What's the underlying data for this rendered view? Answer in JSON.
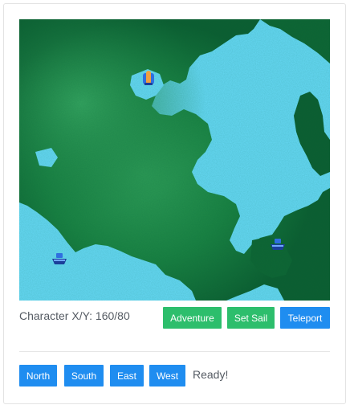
{
  "status": {
    "coords_label": "Character X/Y: 160/80",
    "message": "Ready!"
  },
  "actions": {
    "adventure": "Adventure",
    "set_sail": "Set Sail",
    "teleport": "Teleport"
  },
  "directions": {
    "north": "North",
    "south": "South",
    "east": "East",
    "west": "West"
  },
  "colors": {
    "water": "#66d9f5",
    "land_dark": "#0b5a2e",
    "land_mid": "#167a3e",
    "land_light": "#2a9a55",
    "green_button": "#2dbe6c",
    "blue_button": "#1f8df0"
  },
  "map": {
    "icons": [
      "character-icon",
      "boat-icon",
      "boat-icon"
    ]
  }
}
